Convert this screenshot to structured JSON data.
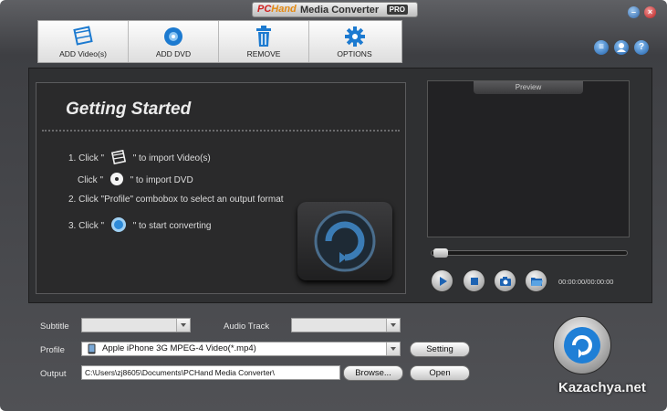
{
  "window": {
    "logo": "PC",
    "logo_suffix": "Hand",
    "title": "Media Converter",
    "badge": "PRO",
    "minimize_glyph": "–",
    "close_glyph": "×"
  },
  "toolbar": {
    "add_video_label": "ADD Video(s)",
    "add_dvd_label": "ADD DVD",
    "remove_label": "REMOVE",
    "options_label": "OPTIONS"
  },
  "header_icons": {
    "menu_icon": "menu-icon",
    "account_icon": "account-icon",
    "help_glyph": "?"
  },
  "getting_started": {
    "title": "Getting Started",
    "step1_prefix": "1. Click \"",
    "step1_suffix": "\" to import Video(s)",
    "step1b_prefix": "Click \"",
    "step1b_suffix": "\" to import DVD",
    "step2": "2. Click \"Profile\" combobox to select an output format",
    "step3_prefix": "3. Click \"",
    "step3_suffix": "\" to start converting"
  },
  "preview": {
    "label": "Preview",
    "time": "00:00:00/00:00:00",
    "seek_progress": 0
  },
  "form": {
    "subtitle_label": "Subtitle",
    "subtitle_value": "",
    "audio_track_label": "Audio Track",
    "audio_track_value": "",
    "profile_label": "Profile",
    "profile_value": "Apple iPhone 3G MPEG-4 Video(*.mp4)",
    "setting_button": "Setting",
    "output_label": "Output",
    "output_value": "C:\\Users\\zj8605\\Documents\\PCHand Media Converter\\",
    "browse_button": "Browse...",
    "open_button": "Open"
  },
  "watermark": "Kazachya.net",
  "colors": {
    "accent_blue": "#1f7fd6",
    "panel_dark": "#2a2a2b",
    "window_gray": "#4a4b4f"
  }
}
